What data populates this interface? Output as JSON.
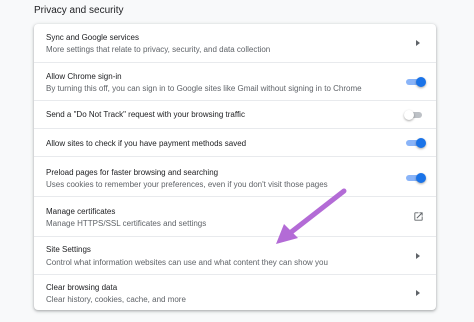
{
  "section_title": "Privacy and security",
  "rows": [
    {
      "title": "Sync and Google services",
      "subtitle": "More settings that relate to privacy, security, and data collection",
      "control": "chevron"
    },
    {
      "title": "Allow Chrome sign-in",
      "subtitle": "By turning this off, you can sign in to Google sites like Gmail without signing in to Chrome",
      "control": "toggle",
      "on": true
    },
    {
      "title": "Send a \"Do Not Track\" request with your browsing traffic",
      "subtitle": "",
      "control": "toggle",
      "on": false
    },
    {
      "title": "Allow sites to check if you have payment methods saved",
      "subtitle": "",
      "control": "toggle",
      "on": true
    },
    {
      "title": "Preload pages for faster browsing and searching",
      "subtitle": "Uses cookies to remember your preferences, even if you don't visit those pages",
      "control": "toggle",
      "on": true
    },
    {
      "title": "Manage certificates",
      "subtitle": "Manage HTTPS/SSL certificates and settings",
      "control": "launch"
    },
    {
      "title": "Site Settings",
      "subtitle": "Control what information websites can use and what content they can show you",
      "control": "chevron"
    },
    {
      "title": "Clear browsing data",
      "subtitle": "Clear history, cookies, cache, and more",
      "control": "chevron"
    }
  ],
  "icons": {
    "chevron": "chevron-right-icon",
    "launch": "open-in-new-icon",
    "annotation": "purple-arrow-annotation"
  },
  "colors": {
    "accent": "#1a73e8",
    "annotation_arrow": "#b36bd6"
  }
}
